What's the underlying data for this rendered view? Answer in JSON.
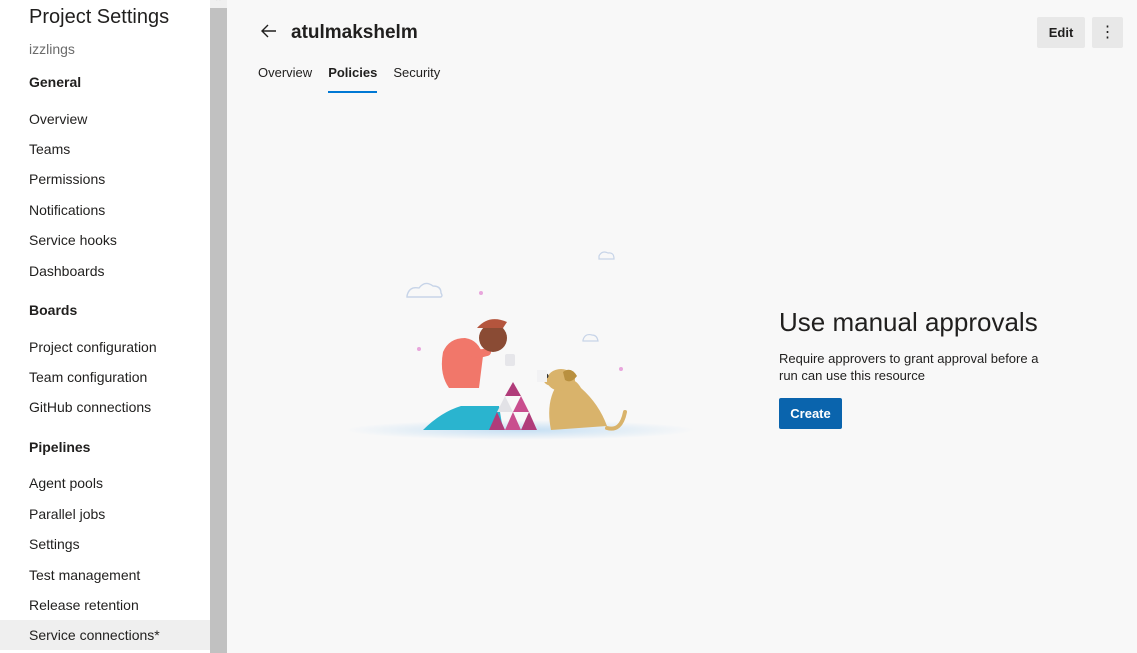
{
  "sidebar": {
    "title": "Project Settings",
    "org": "izzlings",
    "sections": {
      "general": "General",
      "boards": "Boards",
      "pipelines": "Pipelines"
    },
    "general_items": [
      "Overview",
      "Teams",
      "Permissions",
      "Notifications",
      "Service hooks",
      "Dashboards"
    ],
    "boards_items": [
      "Project configuration",
      "Team configuration",
      "GitHub connections"
    ],
    "pipelines_items": [
      "Agent pools",
      "Parallel jobs",
      "Settings",
      "Test management",
      "Release retention",
      "Service connections*"
    ]
  },
  "header": {
    "title": "atulmakshelm",
    "edit_label": "Edit",
    "more_label": "⋮"
  },
  "tabs": [
    {
      "label": "Overview",
      "active": false
    },
    {
      "label": "Policies",
      "active": true
    },
    {
      "label": "Security",
      "active": false
    }
  ],
  "empty_state": {
    "title": "Use manual approvals",
    "description": "Require approvers to grant approval before a run can use this resource",
    "button_label": "Create"
  },
  "colors": {
    "accent": "#0078d4",
    "primary_button": "#0a64ad"
  },
  "icons": {
    "back": "arrow-left-icon",
    "more": "more-vertical-icon"
  }
}
